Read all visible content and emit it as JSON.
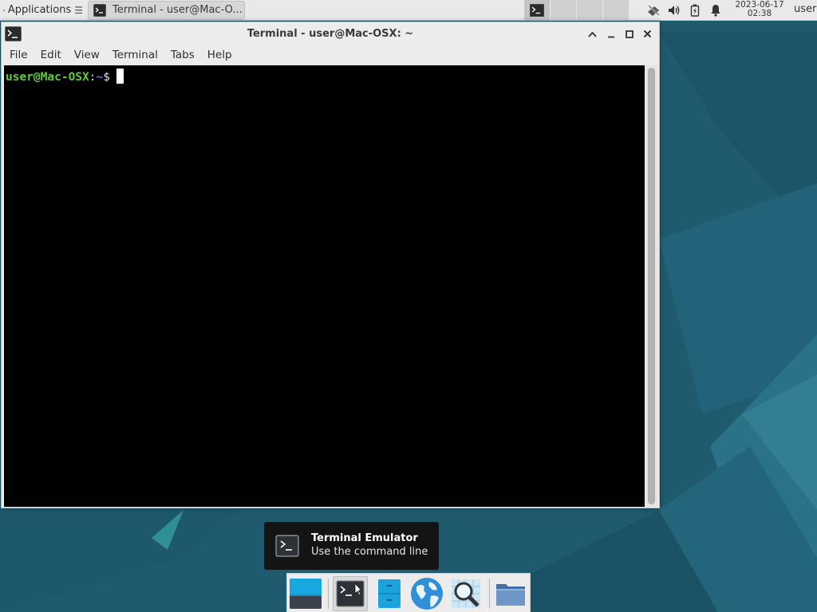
{
  "top_panel": {
    "applications_label": "Applications",
    "task_title": "Terminal - user@Mac-O...",
    "clock_date": "2023-06-17",
    "clock_time": "02:38",
    "user": "user"
  },
  "window": {
    "title": "Terminal - user@Mac-OSX: ~",
    "menu": [
      "File",
      "Edit",
      "View",
      "Terminal",
      "Tabs",
      "Help"
    ]
  },
  "terminal": {
    "prompt_user": "user@Mac-OSX",
    "prompt_colon": ":",
    "prompt_path": "~",
    "prompt_symbol": "$"
  },
  "tooltip": {
    "title": "Terminal Emulator",
    "description": "Use the command line"
  },
  "dock": {
    "items": [
      "show-desktop",
      "terminal",
      "file-cabinet",
      "web-browser",
      "app-finder",
      "folder"
    ]
  },
  "colors": {
    "desktop_bg": "#1f5a6e",
    "prompt_user": "#5fcd3a",
    "prompt_path": "#5c78d8"
  }
}
